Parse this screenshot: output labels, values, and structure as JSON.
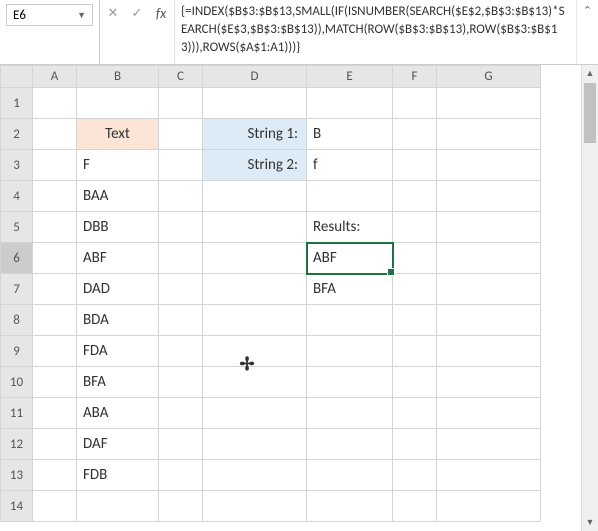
{
  "nameBox": {
    "value": "E6"
  },
  "formulaBar": {
    "cancel": "✕",
    "confirm": "✓",
    "fx": "fx",
    "text": "{=INDEX($B$3:$B$13,SMALL(IF(ISNUMBER(SEARCH($E$2,$B$3:$B$13)*SEARCH($E$3,$B$3:$B$13)),MATCH(ROW($B$3:$B$13),ROW($B$3:$B$13))),ROWS($A$1:A1)))}"
  },
  "columns": [
    "A",
    "B",
    "C",
    "D",
    "E",
    "F",
    "G"
  ],
  "rows": [
    "1",
    "2",
    "3",
    "4",
    "5",
    "6",
    "7",
    "8",
    "9",
    "10",
    "11",
    "12",
    "13",
    "14"
  ],
  "activeRow": "6",
  "headers": {
    "text": "Text",
    "string1": "String 1:",
    "string2": "String 2:",
    "results": "Results:"
  },
  "inputs": {
    "string1": "B",
    "string2": "f"
  },
  "textList": [
    "F",
    "BAA",
    "DBB",
    "ABF",
    "DAD",
    "BDA",
    "FDA",
    "BFA",
    "ABA",
    "DAF",
    "FDB"
  ],
  "results": [
    "ABF",
    "BFA"
  ],
  "cursorGlyph": "✢",
  "chart_data": {
    "type": "table",
    "title": "",
    "columns": [
      "Text"
    ],
    "rows": [
      [
        "F"
      ],
      [
        "BAA"
      ],
      [
        "DBB"
      ],
      [
        "ABF"
      ],
      [
        "DAD"
      ],
      [
        "BDA"
      ],
      [
        "FDA"
      ],
      [
        "BFA"
      ],
      [
        "ABA"
      ],
      [
        "DAF"
      ],
      [
        "FDB"
      ]
    ],
    "lookup": {
      "String 1": "B",
      "String 2": "f"
    },
    "results": [
      "ABF",
      "BFA"
    ]
  }
}
